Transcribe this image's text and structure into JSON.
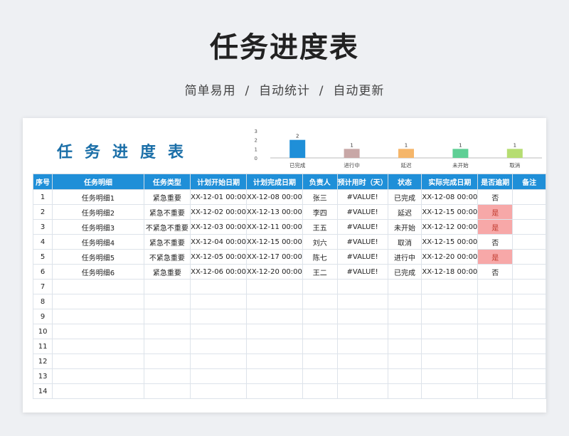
{
  "hero": {
    "title": "任务进度表",
    "subtitle": "简单易用  /  自动统计  /  自动更新"
  },
  "sheet": {
    "title": "任务进度表",
    "columns": [
      "序号",
      "任务明细",
      "任务类型",
      "计划开始日期",
      "计划完成日期",
      "负责人",
      "预计用时（天）",
      "状态",
      "实际完成日期",
      "是否逾期",
      "备注"
    ],
    "rows": [
      [
        "1",
        "任务明细1",
        "紧急重要",
        "XX-12-01 00:00",
        "XX-12-08 00:00",
        "张三",
        "#VALUE!",
        "已完成",
        "XX-12-08 00:00",
        "否",
        ""
      ],
      [
        "2",
        "任务明细2",
        "紧急不重要",
        "XX-12-02 00:00",
        "XX-12-13 00:00",
        "李四",
        "#VALUE!",
        "延迟",
        "XX-12-15 00:00",
        "是",
        ""
      ],
      [
        "3",
        "任务明细3",
        "不紧急不重要",
        "XX-12-03 00:00",
        "XX-12-11 00:00",
        "王五",
        "#VALUE!",
        "未开始",
        "XX-12-12 00:00",
        "是",
        ""
      ],
      [
        "4",
        "任务明细4",
        "紧急不重要",
        "XX-12-04 00:00",
        "XX-12-15 00:00",
        "刘六",
        "#VALUE!",
        "取消",
        "XX-12-15 00:00",
        "否",
        ""
      ],
      [
        "5",
        "任务明细5",
        "不紧急重要",
        "XX-12-05 00:00",
        "XX-12-17 00:00",
        "陈七",
        "#VALUE!",
        "进行中",
        "XX-12-20 00:00",
        "是",
        ""
      ],
      [
        "6",
        "任务明细6",
        "紧急重要",
        "XX-12-06 00:00",
        "XX-12-20 00:00",
        "王二",
        "#VALUE!",
        "已完成",
        "XX-12-18 00:00",
        "否",
        ""
      ],
      [
        "7",
        "",
        "",
        "",
        "",
        "",
        "",
        "",
        "",
        "",
        ""
      ],
      [
        "8",
        "",
        "",
        "",
        "",
        "",
        "",
        "",
        "",
        "",
        ""
      ],
      [
        "9",
        "",
        "",
        "",
        "",
        "",
        "",
        "",
        "",
        "",
        ""
      ],
      [
        "10",
        "",
        "",
        "",
        "",
        "",
        "",
        "",
        "",
        "",
        ""
      ],
      [
        "11",
        "",
        "",
        "",
        "",
        "",
        "",
        "",
        "",
        "",
        ""
      ],
      [
        "12",
        "",
        "",
        "",
        "",
        "",
        "",
        "",
        "",
        "",
        ""
      ],
      [
        "13",
        "",
        "",
        "",
        "",
        "",
        "",
        "",
        "",
        "",
        ""
      ],
      [
        "14",
        "",
        "",
        "",
        "",
        "",
        "",
        "",
        "",
        "",
        ""
      ]
    ]
  },
  "chart_data": {
    "type": "bar",
    "categories": [
      "已完成",
      "进行中",
      "延迟",
      "未开始",
      "取消"
    ],
    "values": [
      2,
      1,
      1,
      1,
      1
    ],
    "colors": [
      "#1f8fd8",
      "#c8a7a6",
      "#f5b66a",
      "#5fcf95",
      "#b6dd72"
    ],
    "yticks": [
      0,
      1,
      2,
      3
    ],
    "ylim": [
      0,
      3
    ],
    "title": "",
    "xlabel": "",
    "ylabel": ""
  }
}
